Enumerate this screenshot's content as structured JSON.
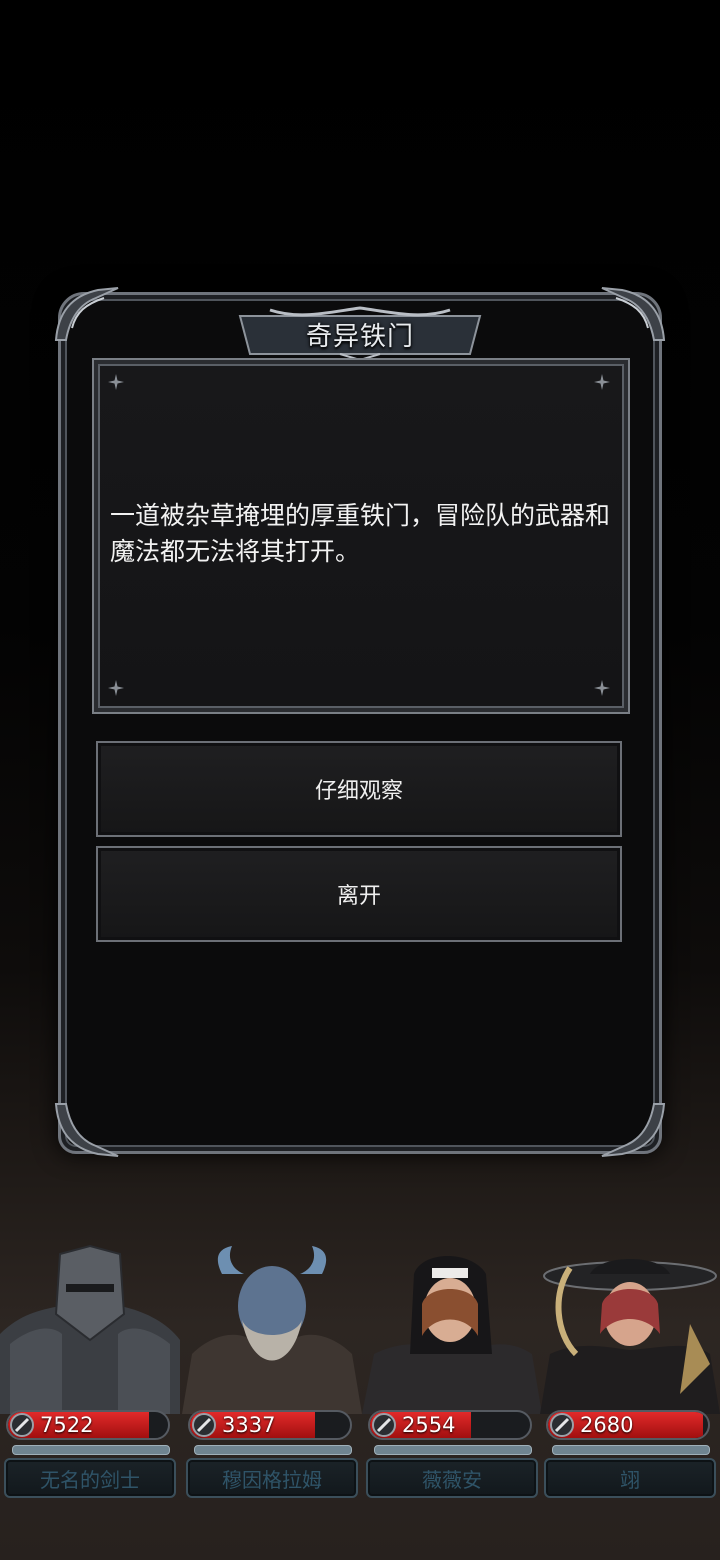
{
  "event": {
    "title": "奇异铁门",
    "description": "一道被杂草掩埋的厚重铁门，冒险队的武器和魔法都无法将其打开。",
    "choices": [
      {
        "label": "仔细观察"
      },
      {
        "label": "离开"
      }
    ]
  },
  "party": [
    {
      "name": "无名的剑士",
      "hp": "7522",
      "hp_fraction": 0.88,
      "portrait": "armored-knight-portrait"
    },
    {
      "name": "穆因格拉姆",
      "hp": "3337",
      "hp_fraction": 0.78,
      "portrait": "horned-blue-dwarf-portrait"
    },
    {
      "name": "薇薇安",
      "hp": "2554",
      "hp_fraction": 0.63,
      "portrait": "nun-fighter-portrait"
    },
    {
      "name": "翊",
      "hp": "2680",
      "hp_fraction": 0.97,
      "portrait": "hat-claw-woman-portrait"
    }
  ],
  "colors": {
    "hp_fill": "#c41b1b",
    "frame": "#6f747c",
    "name_text": "#2f5468"
  }
}
